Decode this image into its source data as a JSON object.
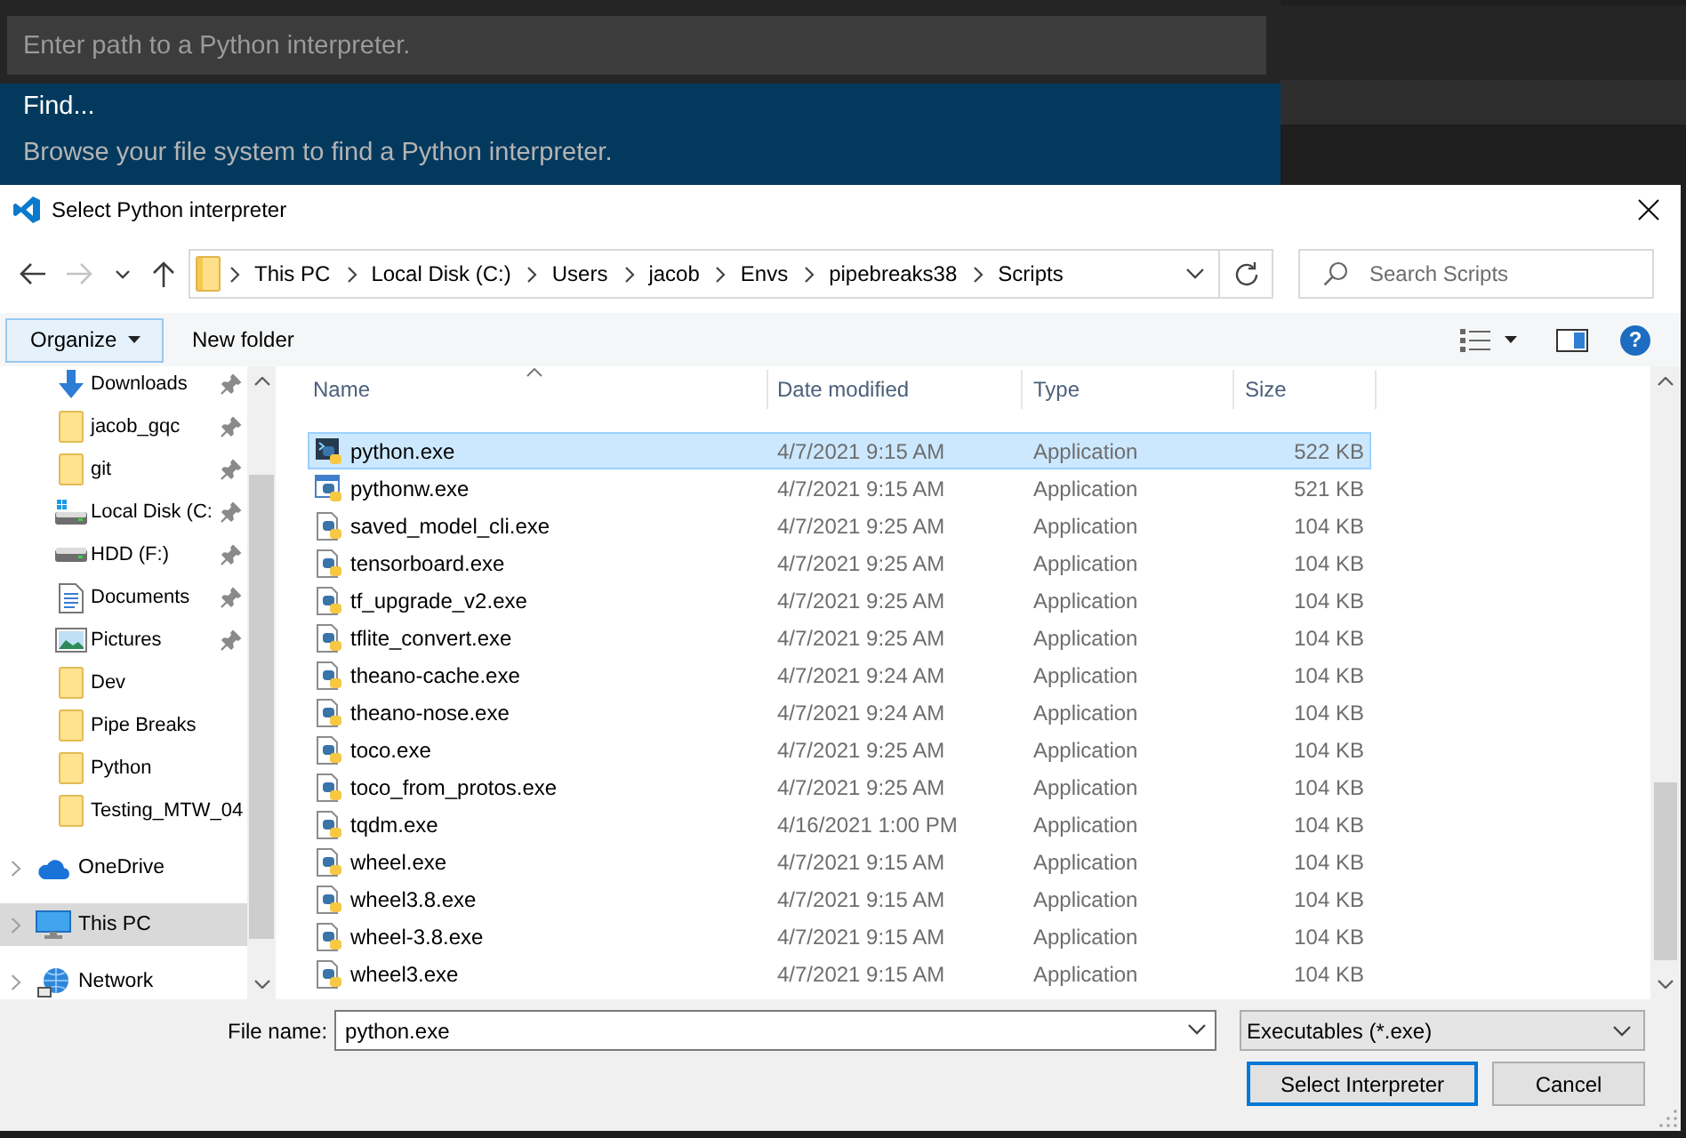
{
  "quick_pick": {
    "placeholder": "Enter path to a Python interpreter.",
    "items": [
      {
        "label": "Find...",
        "description": "Browse your file system to find a Python interpreter.",
        "selected": true
      }
    ]
  },
  "dialog": {
    "title": "Select Python interpreter"
  },
  "nav_buttons": [
    {
      "kind": "back",
      "disabled": false
    },
    {
      "kind": "forward",
      "disabled": true
    },
    {
      "kind": "recent",
      "disabled": false
    },
    {
      "kind": "up",
      "disabled": false
    }
  ],
  "address_bar": {
    "crumbs": [
      "This PC",
      "Local Disk (C:)",
      "Users",
      "jacob",
      "Envs",
      "pipebreaks38",
      "Scripts"
    ]
  },
  "search": {
    "placeholder": "Search Scripts"
  },
  "toolbar": {
    "organize": "Organize",
    "new_folder": "New folder",
    "help": "?"
  },
  "sidebar": {
    "quick_access": [
      {
        "label": "Downloads",
        "kind": "downloads",
        "pinned": true,
        "selected": false
      },
      {
        "label": "jacob_gqc",
        "kind": "folder",
        "pinned": true,
        "selected": false
      },
      {
        "label": "git",
        "kind": "folder",
        "pinned": true,
        "selected": false
      },
      {
        "label": "Local Disk (C:",
        "kind": "system_drive",
        "pinned": true,
        "selected": false
      },
      {
        "label": "HDD (F:)",
        "kind": "drive",
        "pinned": true,
        "selected": false
      },
      {
        "label": "Documents",
        "kind": "documents",
        "pinned": true,
        "selected": false
      },
      {
        "label": "Pictures",
        "kind": "pictures",
        "pinned": true,
        "selected": false
      },
      {
        "label": "Dev",
        "kind": "folder",
        "pinned": false,
        "selected": false
      },
      {
        "label": "Pipe Breaks",
        "kind": "folder",
        "pinned": false,
        "selected": false
      },
      {
        "label": "Python",
        "kind": "folder",
        "pinned": false,
        "selected": false
      },
      {
        "label": "Testing_MTW_04",
        "kind": "folder",
        "pinned": false,
        "selected": false
      }
    ],
    "roots": [
      {
        "label": "OneDrive",
        "kind": "cloud",
        "expanded": false,
        "selected": false
      },
      {
        "label": "This PC",
        "kind": "computer",
        "expanded": false,
        "selected": true
      },
      {
        "label": "Network",
        "kind": "network",
        "expanded": false,
        "selected": false
      }
    ]
  },
  "file_list": {
    "columns": [
      {
        "label": "Name",
        "sorted": true
      },
      {
        "label": "Date modified",
        "sorted": false
      },
      {
        "label": "Type",
        "sorted": false
      },
      {
        "label": "Size",
        "sorted": false
      }
    ],
    "rows": [
      {
        "name": "python.exe",
        "date": "4/7/2021 9:15 AM",
        "type": "Application",
        "size": "522 KB",
        "kind": "console",
        "selected": true
      },
      {
        "name": "pythonw.exe",
        "date": "4/7/2021 9:15 AM",
        "type": "Application",
        "size": "521 KB",
        "kind": "window",
        "selected": false
      },
      {
        "name": "saved_model_cli.exe",
        "date": "4/7/2021 9:25 AM",
        "type": "Application",
        "size": "104 KB",
        "kind": "script",
        "selected": false
      },
      {
        "name": "tensorboard.exe",
        "date": "4/7/2021 9:25 AM",
        "type": "Application",
        "size": "104 KB",
        "kind": "script",
        "selected": false
      },
      {
        "name": "tf_upgrade_v2.exe",
        "date": "4/7/2021 9:25 AM",
        "type": "Application",
        "size": "104 KB",
        "kind": "script",
        "selected": false
      },
      {
        "name": "tflite_convert.exe",
        "date": "4/7/2021 9:25 AM",
        "type": "Application",
        "size": "104 KB",
        "kind": "script",
        "selected": false
      },
      {
        "name": "theano-cache.exe",
        "date": "4/7/2021 9:24 AM",
        "type": "Application",
        "size": "104 KB",
        "kind": "script",
        "selected": false
      },
      {
        "name": "theano-nose.exe",
        "date": "4/7/2021 9:24 AM",
        "type": "Application",
        "size": "104 KB",
        "kind": "script",
        "selected": false
      },
      {
        "name": "toco.exe",
        "date": "4/7/2021 9:25 AM",
        "type": "Application",
        "size": "104 KB",
        "kind": "script",
        "selected": false
      },
      {
        "name": "toco_from_protos.exe",
        "date": "4/7/2021 9:25 AM",
        "type": "Application",
        "size": "104 KB",
        "kind": "script",
        "selected": false
      },
      {
        "name": "tqdm.exe",
        "date": "4/16/2021 1:00 PM",
        "type": "Application",
        "size": "104 KB",
        "kind": "script",
        "selected": false
      },
      {
        "name": "wheel.exe",
        "date": "4/7/2021 9:15 AM",
        "type": "Application",
        "size": "104 KB",
        "kind": "script",
        "selected": false
      },
      {
        "name": "wheel3.8.exe",
        "date": "4/7/2021 9:15 AM",
        "type": "Application",
        "size": "104 KB",
        "kind": "script",
        "selected": false
      },
      {
        "name": "wheel-3.8.exe",
        "date": "4/7/2021 9:15 AM",
        "type": "Application",
        "size": "104 KB",
        "kind": "script",
        "selected": false
      },
      {
        "name": "wheel3.exe",
        "date": "4/7/2021 9:15 AM",
        "type": "Application",
        "size": "104 KB",
        "kind": "script",
        "selected": false
      }
    ]
  },
  "file_name": {
    "label": "File name:",
    "value": "python.exe"
  },
  "file_type": {
    "value": "Executables (*.exe)"
  },
  "buttons": [
    {
      "label": "Select Interpreter",
      "default": true
    },
    {
      "label": "Cancel",
      "default": false
    }
  ]
}
